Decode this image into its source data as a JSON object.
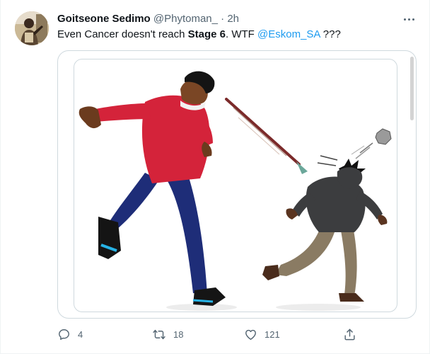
{
  "tweet": {
    "author_name": "Goitseone Sedimo",
    "handle": "@Phytoman_",
    "separator": "·",
    "time": "2h",
    "text_before": "Even Cancer doesn't reach ",
    "text_bold": "Stage 6",
    "text_middle": ". WTF ",
    "mention": "@Eskom_SA",
    "text_after": " ???"
  },
  "actions": {
    "replies": "4",
    "retweets": "18",
    "likes": "121"
  },
  "icons": {
    "more": "more-horizontal-icon",
    "reply": "reply-icon",
    "retweet": "retweet-icon",
    "like": "like-icon",
    "share": "share-icon"
  },
  "colors": {
    "link": "#1d9bf0",
    "secondary_text": "#536471",
    "border": "#cfd9de"
  }
}
